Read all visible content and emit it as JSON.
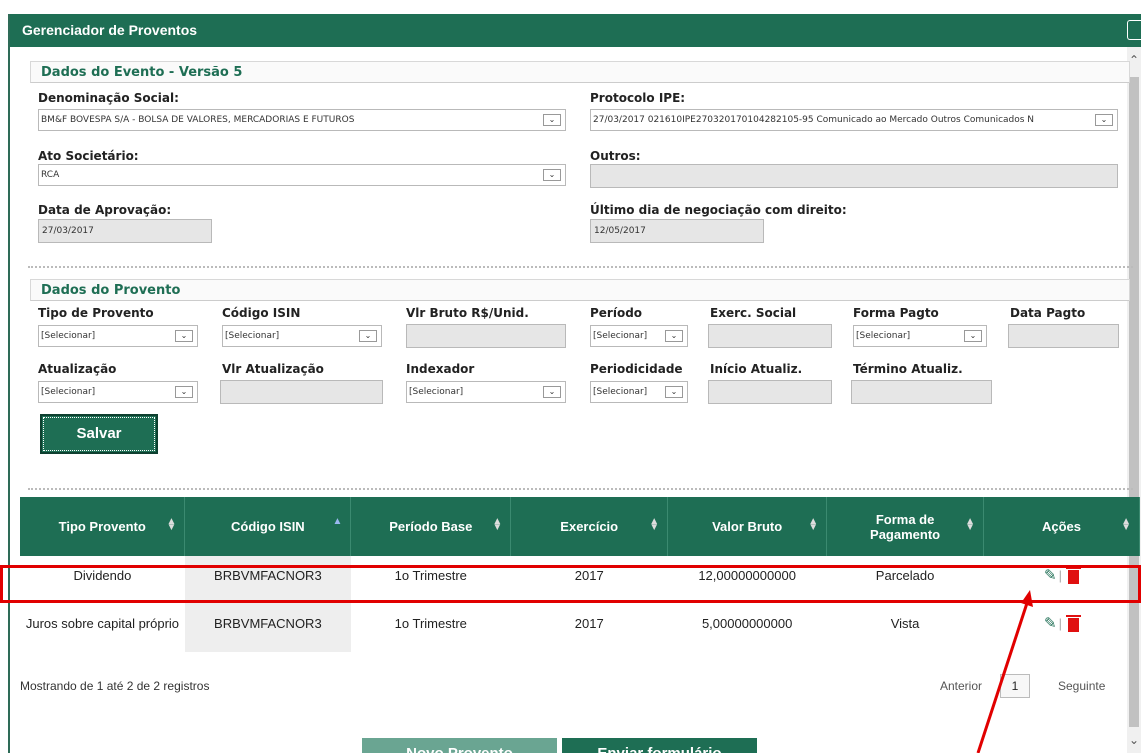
{
  "window": {
    "title": "Gerenciador de Proventos"
  },
  "evento": {
    "heading": "Dados do Evento - Versão 5",
    "denominacao": {
      "label": "Denominação Social:",
      "value": "BM&F BOVESPA S/A - BOLSA DE VALORES, MERCADORIAS E FUTUROS"
    },
    "protocolo": {
      "label": "Protocolo IPE:",
      "value": "27/03/2017 021610IPE270320170104282105-95 Comunicado ao Mercado Outros Comunicados N"
    },
    "ato": {
      "label": "Ato Societário:",
      "value": "RCA"
    },
    "outros": {
      "label": "Outros:",
      "value": ""
    },
    "data_aprov": {
      "label": "Data de Aprovação:",
      "value": "27/03/2017"
    },
    "ultimo_dia": {
      "label": "Último dia de negociação com direito:",
      "value": "12/05/2017"
    }
  },
  "provento": {
    "heading": "Dados do Provento",
    "tipo": {
      "label": "Tipo de Provento",
      "value": "[Selecionar]"
    },
    "isin": {
      "label": "Código ISIN",
      "value": "[Selecionar]"
    },
    "vlr_bruto": {
      "label": "Vlr Bruto R$/Unid.",
      "value": ""
    },
    "periodo": {
      "label": "Período",
      "value": "[Selecionar]"
    },
    "exerc": {
      "label": "Exerc. Social",
      "value": ""
    },
    "forma": {
      "label": "Forma Pagto",
      "value": "[Selecionar]"
    },
    "data_pagto": {
      "label": "Data Pagto",
      "value": ""
    },
    "atualizacao": {
      "label": "Atualização",
      "value": "[Selecionar]"
    },
    "vlr_atual": {
      "label": "Vlr Atualização",
      "value": ""
    },
    "indexador": {
      "label": "Indexador",
      "value": "[Selecionar]"
    },
    "periodicidade": {
      "label": "Periodicidade",
      "value": "[Selecionar]"
    },
    "inicio": {
      "label": "Início Atualiz.",
      "value": ""
    },
    "termino": {
      "label": "Término Atualiz.",
      "value": ""
    },
    "salvar": "Salvar"
  },
  "table": {
    "headers": [
      "Tipo Provento",
      "Código ISIN",
      "Período Base",
      "Exercício",
      "Valor Bruto",
      "Forma de Pagamento",
      "Ações"
    ],
    "rows": [
      [
        "Dividendo",
        "BRBVMFACNOR3",
        "1o Trimestre",
        "2017",
        "12,00000000000",
        "Parcelado"
      ],
      [
        "Juros sobre capital próprio",
        "BRBVMFACNOR3",
        "1o Trimestre",
        "2017",
        "5,00000000000",
        "Vista"
      ]
    ]
  },
  "footer": {
    "info": "Mostrando de 1 até 2 de 2 registros",
    "prev": "Anterior",
    "page": "1",
    "next": "Seguinte",
    "novo": "Novo Provento",
    "enviar": "Enviar formulário"
  },
  "colors": {
    "primary": "#1e6e54",
    "highlight": "#e10000"
  }
}
